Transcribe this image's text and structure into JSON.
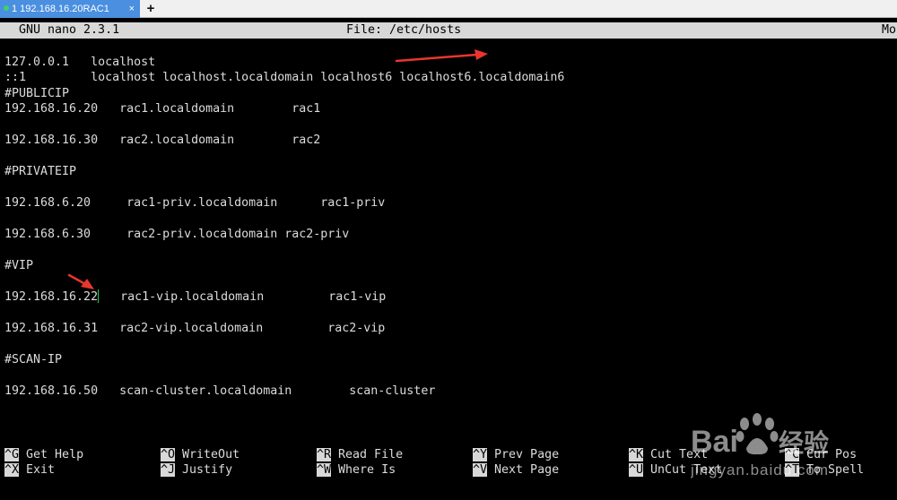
{
  "tab": {
    "label": "1 192.168.16.20RAC1",
    "close_label": "×",
    "new_tab_label": "+"
  },
  "titlebar": {
    "version": "GNU nano 2.3.1",
    "file": "File: /etc/hosts",
    "modified": "Mo"
  },
  "editor": {
    "lines": [
      "127.0.0.1   localhost",
      "::1         localhost localhost.localdomain localhost6 localhost6.localdomain6",
      "#PUBLICIP",
      "192.168.16.20   rac1.localdomain        rac1",
      "",
      "192.168.16.30   rac2.localdomain        rac2",
      "",
      "#PRIVATEIP",
      "",
      "192.168.6.20     rac1-priv.localdomain      rac1-priv",
      "",
      "192.168.6.30     rac2-priv.localdomain rac2-priv",
      "",
      "#VIP",
      "",
      "192.168.16.22",
      "",
      "192.168.16.31   rac2-vip.localdomain         rac2-vip",
      "",
      "#SCAN-IP",
      "",
      "192.168.16.50   scan-cluster.localdomain        scan-cluster"
    ],
    "cursor_line_rest": "   rac1-vip.localdomain         rac1-vip"
  },
  "shortcuts": [
    {
      "key": "^G",
      "label": "Get Help"
    },
    {
      "key": "^O",
      "label": "WriteOut"
    },
    {
      "key": "^R",
      "label": "Read File"
    },
    {
      "key": "^Y",
      "label": "Prev Page"
    },
    {
      "key": "^K",
      "label": "Cut Text"
    },
    {
      "key": "^C",
      "label": "Cur Pos"
    },
    {
      "key": "^X",
      "label": "Exit"
    },
    {
      "key": "^J",
      "label": "Justify"
    },
    {
      "key": "^W",
      "label": "Where Is"
    },
    {
      "key": "^V",
      "label": "Next Page"
    },
    {
      "key": "^U",
      "label": "UnCut Text"
    },
    {
      "key": "^T",
      "label": "To Spell"
    }
  ],
  "watermark": {
    "text": "Bai 经验",
    "url_text": "jingyan.baidu.com"
  },
  "colors": {
    "tab_active": "#4a8fe0",
    "status_bar": "#d8d8d8",
    "terminal_bg": "#000000",
    "arrow": "#e8362f",
    "cursor": "#22cc55"
  }
}
